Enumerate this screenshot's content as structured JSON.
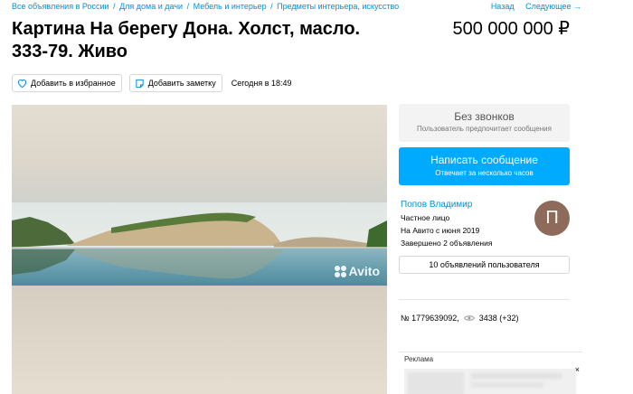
{
  "breadcrumbs": [
    "Все объявления в России",
    "Для дома и дачи",
    "Мебель и интерьер",
    "Предметы интерьера, искусство"
  ],
  "breadcrumb_separator": "/",
  "pager": {
    "back": "Назад",
    "next": "Следующее →"
  },
  "listing": {
    "title": "Картина На берегу Дона. Холст, масло. 333-79. Живо",
    "price": "500 000 000 ₽"
  },
  "actions": {
    "favorite": "Добавить в избранное",
    "note": "Добавить заметку",
    "date": "Сегодня в 18:49"
  },
  "gallery": {
    "watermark": "Avito"
  },
  "contact": {
    "no_calls_title": "Без звонков",
    "no_calls_subtitle": "Пользователь предпочитает сообщения",
    "write_title": "Написать сообщение",
    "write_subtitle": "Отвечает за несколько часов"
  },
  "seller": {
    "name": "Попов Владимир",
    "type": "Частное лицо",
    "since": "На Авито с июня 2019",
    "completed": "Завершено 2 объявления",
    "avatar_letter": "П",
    "user_ads": "10 объявлений пользователя"
  },
  "ad_meta": {
    "number": "№ 1779639092,",
    "views": "3438 (+32)"
  },
  "advert": {
    "label": "Реклама",
    "close": "×"
  },
  "colors": {
    "link": "#0091d9",
    "primary_button": "#00aaff",
    "avatar": "#8e6a5a"
  }
}
